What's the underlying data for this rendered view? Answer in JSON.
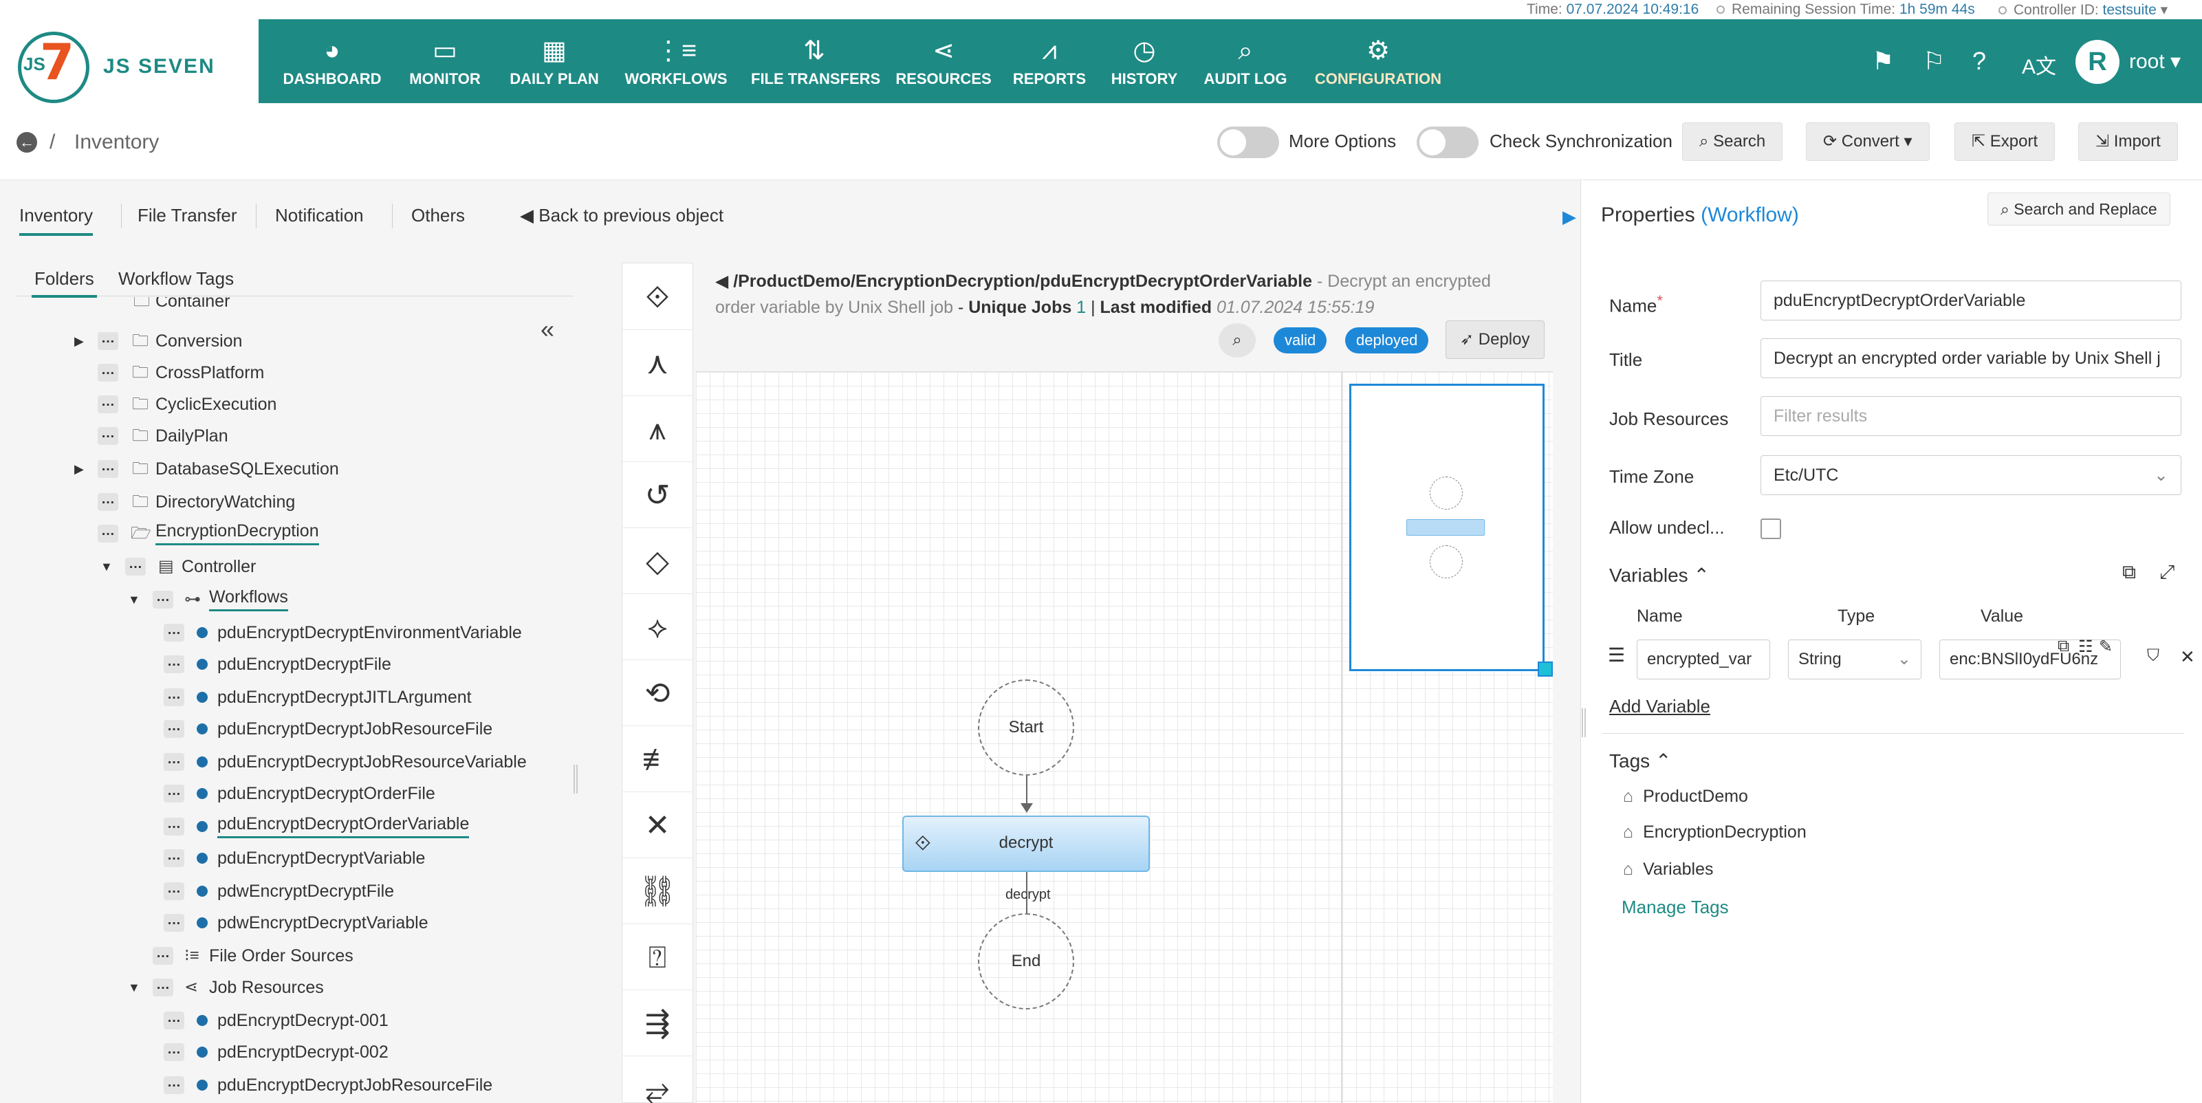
{
  "status": {
    "time_label": "Time:",
    "time_value": "07.07.2024 10:49:16",
    "session_label": "Remaining Session Time:",
    "session_value": "1h 59m 44s",
    "controller_label": "Controller ID:",
    "controller_value": "testsuite"
  },
  "brand": {
    "name": "JS SEVEN",
    "mark": "JS",
    "digit": "7"
  },
  "nav": [
    {
      "label": "DASHBOARD",
      "icon": "dashboard-icon",
      "glyph": "◕"
    },
    {
      "label": "MONITOR",
      "icon": "monitor-icon",
      "glyph": "▭"
    },
    {
      "label": "DAILY PLAN",
      "icon": "calendar-clock-icon",
      "glyph": "▦"
    },
    {
      "label": "WORKFLOWS",
      "icon": "workflow-icon",
      "glyph": "⋮≡"
    },
    {
      "label": "FILE TRANSFERS",
      "icon": "transfer-icon",
      "glyph": "⇅"
    },
    {
      "label": "RESOURCES",
      "icon": "share-icon",
      "glyph": "⋖"
    },
    {
      "label": "REPORTS",
      "icon": "chart-icon",
      "glyph": "⩘"
    },
    {
      "label": "HISTORY",
      "icon": "alarm-icon",
      "glyph": "◷"
    },
    {
      "label": "AUDIT LOG",
      "icon": "audit-icon",
      "glyph": "⌕"
    },
    {
      "label": "CONFIGURATION",
      "icon": "gear-icon",
      "glyph": "⚙"
    }
  ],
  "user": {
    "initial": "R",
    "name": "root"
  },
  "header": {
    "breadcrumb_sep": "/",
    "title": "Inventory",
    "more_options": "More Options",
    "check_sync": "Check Synchronization",
    "search": "Search",
    "convert": "Convert",
    "export": "Export",
    "import": "Import"
  },
  "tabs": [
    "Inventory",
    "File Transfer",
    "Notification",
    "Others"
  ],
  "back_previous": "Back to previous object",
  "folder_tabs": [
    "Folders",
    "Workflow Tags"
  ],
  "tree": {
    "container": "Container",
    "conversion": "Conversion",
    "crossplatform": "CrossPlatform",
    "cyclic": "CyclicExecution",
    "dailyplan": "DailyPlan",
    "dbsql": "DatabaseSQLExecution",
    "dirwatch": "DirectoryWatching",
    "encdec": "EncryptionDecryption",
    "controller": "Controller",
    "workflows": "Workflows",
    "wf": [
      "pduEncryptDecryptEnvironmentVariable",
      "pduEncryptDecryptFile",
      "pduEncryptDecryptJITLArgument",
      "pduEncryptDecryptJobResourceFile",
      "pduEncryptDecryptJobResourceVariable",
      "pduEncryptDecryptOrderFile",
      "pduEncryptDecryptOrderVariable",
      "pduEncryptDecryptVariable",
      "pdwEncryptDecryptFile",
      "pdwEncryptDecryptVariable"
    ],
    "file_order_sources": "File Order Sources",
    "job_resources": "Job Resources",
    "jr": [
      "pdEncryptDecrypt-001",
      "pdEncryptDecrypt-002",
      "pduEncryptDecryptJobResourceFile"
    ]
  },
  "workflow": {
    "path": "/ProductDemo/EncryptionDecryption/pduEncryptDecryptOrderVariable",
    "desc_dash": " - ",
    "description_1": "Decrypt an encrypted",
    "description_2": "order variable by Unix Shell job",
    "unique_jobs_label": "Unique Jobs",
    "unique_jobs_value": "1",
    "sep": "|",
    "last_modified_label": "Last modified",
    "last_modified_value": "01.07.2024 15:55:19",
    "valid": "valid",
    "deployed": "deployed",
    "deploy": "Deploy",
    "start": "Start",
    "job": "decrypt",
    "edge_label": "decrypt",
    "end": "End"
  },
  "properties": {
    "title": "Properties",
    "type": "(Workflow)",
    "search_replace": "Search and Replace",
    "name_label": "Name",
    "required_mark": "*",
    "name_value": "pduEncryptDecryptOrderVariable",
    "title_label": "Title",
    "title_value": "Decrypt an encrypted order variable by Unix Shell j",
    "job_resources_label": "Job Resources",
    "job_resources_placeholder": "Filter results",
    "timezone_label": "Time Zone",
    "timezone_value": "Etc/UTC",
    "allow_label": "Allow undecl...",
    "variables_label": "Variables",
    "col_name": "Name",
    "col_type": "Type",
    "col_value": "Value",
    "var_name": "encrypted_var",
    "var_type": "String",
    "var_value": "enc:BNSlI0ydFU6nz",
    "add_variable": "Add Variable",
    "tags_label": "Tags",
    "tags": [
      "ProductDemo",
      "EncryptionDecryption",
      "Variables"
    ],
    "manage_tags": "Manage Tags"
  },
  "colors": {
    "brand": "#1e8a84",
    "accent": "#1e88d8",
    "logo_orange": "#e8531f"
  }
}
